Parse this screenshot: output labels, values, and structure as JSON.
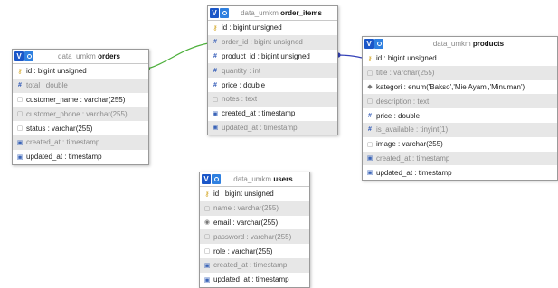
{
  "colors": {
    "link_orders": "#4caf3a",
    "link_products": "#3340b8"
  },
  "tables": {
    "orders": {
      "db": "data_umkm",
      "name": "orders",
      "columns": [
        {
          "text": "id : bigint unsigned",
          "icon": "key-icon",
          "alt": false
        },
        {
          "text": "total : double",
          "icon": "numeric-icon",
          "alt": true
        },
        {
          "text": "customer_name : varchar(255)",
          "icon": "text-icon",
          "alt": false
        },
        {
          "text": "customer_phone : varchar(255)",
          "icon": "text-icon",
          "alt": true
        },
        {
          "text": "status : varchar(255)",
          "icon": "text-icon",
          "alt": false
        },
        {
          "text": "created_at : timestamp",
          "icon": "date-icon",
          "alt": true
        },
        {
          "text": "updated_at : timestamp",
          "icon": "date-icon",
          "alt": false
        }
      ]
    },
    "order_items": {
      "db": "data_umkm",
      "name": "order_items",
      "columns": [
        {
          "text": "id : bigint unsigned",
          "icon": "key-icon",
          "alt": false
        },
        {
          "text": "order_id : bigint unsigned",
          "icon": "numeric-icon",
          "alt": true
        },
        {
          "text": "product_id : bigint unsigned",
          "icon": "numeric-icon",
          "alt": false
        },
        {
          "text": "quantity : int",
          "icon": "numeric-icon",
          "alt": true
        },
        {
          "text": "price : double",
          "icon": "numeric-icon",
          "alt": false
        },
        {
          "text": "notes : text",
          "icon": "text-icon",
          "alt": true
        },
        {
          "text": "created_at : timestamp",
          "icon": "date-icon",
          "alt": false
        },
        {
          "text": "updated_at : timestamp",
          "icon": "date-icon",
          "alt": true
        }
      ]
    },
    "products": {
      "db": "data_umkm",
      "name": "products",
      "columns": [
        {
          "text": "id : bigint unsigned",
          "icon": "key-icon",
          "alt": false
        },
        {
          "text": "title : varchar(255)",
          "icon": "text-icon",
          "alt": true
        },
        {
          "text": "kategori : enum('Bakso','Mie Ayam','Minuman')",
          "icon": "enum-icon",
          "alt": false
        },
        {
          "text": "description : text",
          "icon": "text-icon",
          "alt": true
        },
        {
          "text": "price : double",
          "icon": "numeric-icon",
          "alt": false
        },
        {
          "text": "is_available : tinyint(1)",
          "icon": "numeric-icon",
          "alt": true
        },
        {
          "text": "image : varchar(255)",
          "icon": "text-icon",
          "alt": false
        },
        {
          "text": "created_at : timestamp",
          "icon": "date-icon",
          "alt": true
        },
        {
          "text": "updated_at : timestamp",
          "icon": "date-icon",
          "alt": false
        }
      ]
    },
    "users": {
      "db": "data_umkm",
      "name": "users",
      "columns": [
        {
          "text": "id : bigint unsigned",
          "icon": "key-icon",
          "alt": false
        },
        {
          "text": "name : varchar(255)",
          "icon": "text-icon",
          "alt": true
        },
        {
          "text": "email : varchar(255)",
          "icon": "unique-icon",
          "alt": false
        },
        {
          "text": "password : varchar(255)",
          "icon": "text-icon",
          "alt": true
        },
        {
          "text": "role : varchar(255)",
          "icon": "text-icon",
          "alt": false
        },
        {
          "text": "created_at : timestamp",
          "icon": "date-icon",
          "alt": true
        },
        {
          "text": "updated_at : timestamp",
          "icon": "date-icon",
          "alt": false
        }
      ]
    }
  }
}
